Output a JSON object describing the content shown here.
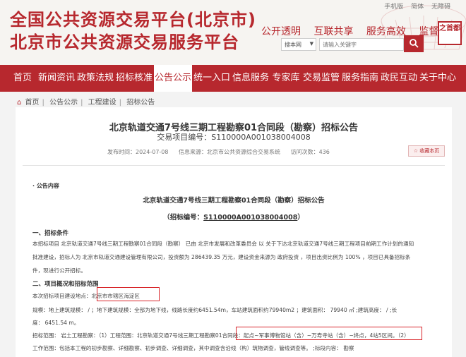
{
  "header": {
    "title_line1": "全国公共资源交易平台(北京市)",
    "title_line2": "北京市公共资源交易服务平台",
    "slogans": [
      "公开透明",
      "互联共享",
      "服务高效",
      "监督规范"
    ],
    "top_links": [
      "手机版",
      "简体",
      "无障碍"
    ],
    "seal_text": "之首都",
    "site_select_value": "搜本网",
    "search_placeholder": "请输入关键字"
  },
  "nav": {
    "items": [
      "首页",
      "新闻资讯",
      "政策法规",
      "招标核准",
      "公告公示",
      "统一入口",
      "信息服务",
      "专家库",
      "交易监管",
      "服务指南",
      "政民互动",
      "关于中心"
    ],
    "active_index": 4
  },
  "breadcrumb": [
    "首页",
    "公告公示",
    "工程建设",
    "招标公告"
  ],
  "article": {
    "title": "北京轨道交通7号线三期工程勘察01合同段（勘察）招标公告",
    "subtitle": "交易项目编号：S110000A001038004008",
    "meta": {
      "publish_time": "发布时间：2024-07-08",
      "source": "信息来源：北京市公共资源综合交易系统",
      "views": "访问次数：436"
    },
    "favorite_label": "收藏本页",
    "section_label": "· 公告内容",
    "notice_title": "北京轨道交通7号线三期工程勘察01合同段（勘察）招标公告",
    "notice_code_prefix": "（招标编号：",
    "notice_code": "S110000A001038004008",
    "notice_code_suffix": "）",
    "cond_heading": "一、招标条件",
    "cond_line1": "本招标项目 北京轨道交通7号线三期工程勘察01合同段（勘察） 已由 北京市发展和改革委员会 以 关于下达北京轨道交通7号线三期工程项目前期工作计划的通知",
    "cond_line2": "批准建设，招标人为 北京市轨道交通建设管理有限公司，投资额为 286439.35 万元，建设资金来源为 政府投资 ，项目出资比例为 100% ，项目已具备招标条",
    "cond_line3": "件，现进行公开招标。",
    "scope_heading": "二、项目概况和招标范围",
    "scope_location": "本次招标项目建设地点：北京市市辖区海淀区",
    "scope_line1": "规模：地上建筑规模： / ；地下建筑规模：全部为地下线，线路长度约6451.54m，车站建筑面积约79940m2 ；建筑面积： 79940 ㎡ ;建筑高度： / ;长",
    "scope_line2": "度： 6451.54 m。",
    "scope_line3": "招标范围： 岩土工程勘察：（1）工程范围：北京轨道交通7号线三期工程勘察01合同段：起点~军事博物馆站（含）~万寿寺站（含）~终点，4站5区间。（2）",
    "scope_line4": "工作范围：包括本工程的初步勘察、详细勘察、初步调查、详细调查，其中调查含沿线（构）筑物调查，管线调查等。 ;标段内容： 勘察"
  },
  "colors": {
    "brand_red": "#b7282e",
    "highlight_red": "#d8262b"
  }
}
